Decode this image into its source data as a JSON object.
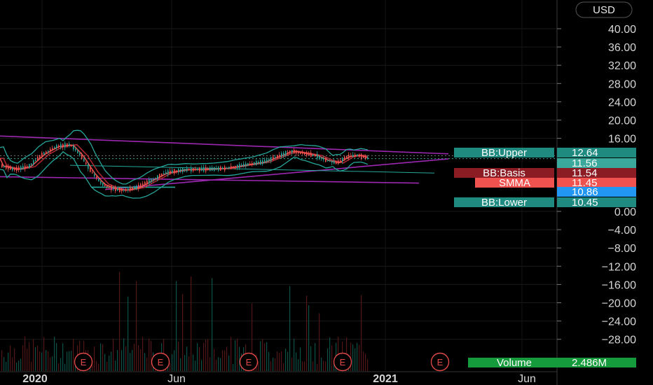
{
  "currency": "USD",
  "colors": {
    "background": "#000000",
    "bb_band": "#26a69a",
    "bb_basis": "#b22833",
    "smma": "#f0524f",
    "last_price": "#2196f3",
    "trendline": "#9c27b0",
    "volume_bar": "#26a69a",
    "earnings": "#e04848"
  },
  "price_tags": [
    {
      "label": "BB:Upper",
      "value": "12.64",
      "color": "#1f8a80"
    },
    {
      "label": "",
      "value": "11.56",
      "color": "#3aa89b"
    },
    {
      "label": "BB:Basis",
      "value": "11.54",
      "color": "#8b1c23"
    },
    {
      "label": "SMMA",
      "value": "11.45",
      "color": "#f0524f"
    },
    {
      "label": "",
      "value": "10.86",
      "color": "#2196f3"
    },
    {
      "label": "BB:Lower",
      "value": "10.45",
      "color": "#1f8a80"
    }
  ],
  "volume_tag": {
    "label": "Volume",
    "value": "2.486M",
    "color": "#169b3c"
  },
  "earnings_markers": [
    "E",
    "E",
    "E",
    "E",
    "E"
  ],
  "chart_data": {
    "type": "candlestick",
    "y_axis": {
      "ticks": [
        40,
        36,
        32,
        28,
        24,
        20,
        16,
        0,
        -4,
        -8,
        -12,
        -16,
        -20,
        -24,
        -28
      ],
      "tick_labels": [
        "40.00",
        "36.00",
        "32.00",
        "28.00",
        "24.00",
        "20.00",
        "16.00",
        "0.00",
        "−4.00",
        "−8.00",
        "−12.00",
        "−16.00",
        "−20.00",
        "−24.00",
        "−28.00"
      ],
      "range": [
        -30,
        43
      ]
    },
    "x_axis": {
      "tick_labels": [
        "2020",
        "Jun",
        "2021",
        "Jun"
      ]
    },
    "series": [
      {
        "name": "BB:Upper",
        "last": 12.64
      },
      {
        "name": "BB:Basis",
        "last": 11.54
      },
      {
        "name": "SMMA",
        "last": 11.45
      },
      {
        "name": "BB:Lower",
        "last": 10.45
      },
      {
        "name": "Volume",
        "last": "2.486M"
      }
    ],
    "last_close": 10.86,
    "grid": true
  }
}
